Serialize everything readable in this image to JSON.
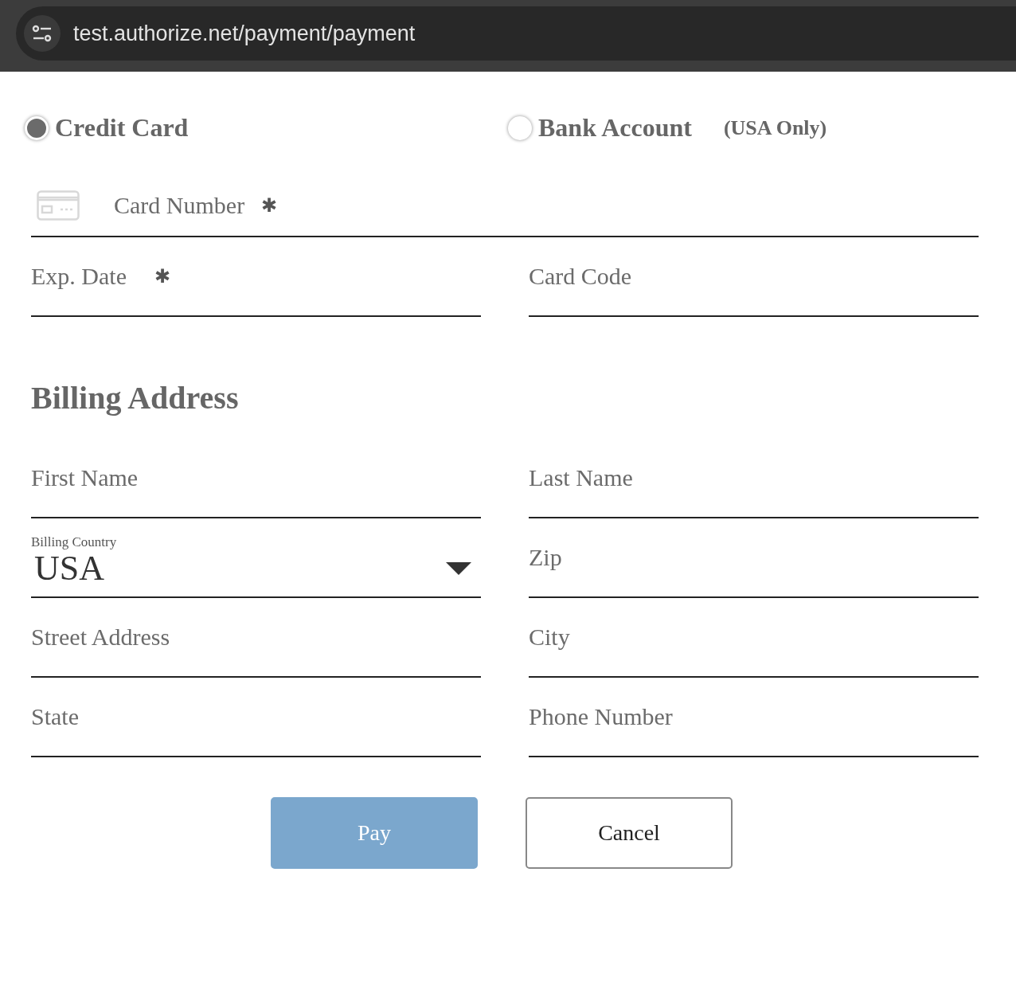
{
  "browser": {
    "url": "test.authorize.net/payment/payment"
  },
  "payment_methods": [
    {
      "label": "Credit Card",
      "selected": true
    },
    {
      "label": "Bank Account",
      "selected": false,
      "note": "(USA Only)"
    }
  ],
  "card_number": {
    "placeholder": "Card Number",
    "required_mark": "✱"
  },
  "card_fields": [
    {
      "placeholder": "Exp. Date",
      "required_mark": "✱"
    },
    {
      "placeholder": "Card Code"
    }
  ],
  "billing": {
    "title": "Billing Address",
    "fields": [
      {
        "kind": "text",
        "placeholder": "First Name"
      },
      {
        "kind": "text",
        "placeholder": "Last Name"
      },
      {
        "kind": "select",
        "label": "Billing Country",
        "value": "USA"
      },
      {
        "kind": "text",
        "placeholder": "Zip"
      },
      {
        "kind": "text",
        "placeholder": "Street Address"
      },
      {
        "kind": "text",
        "placeholder": "City"
      },
      {
        "kind": "text",
        "placeholder": "State"
      },
      {
        "kind": "text",
        "placeholder": "Phone Number"
      }
    ]
  },
  "buttons": [
    {
      "kind": "primary",
      "label": "Pay"
    },
    {
      "kind": "secondary",
      "label": "Cancel"
    }
  ]
}
